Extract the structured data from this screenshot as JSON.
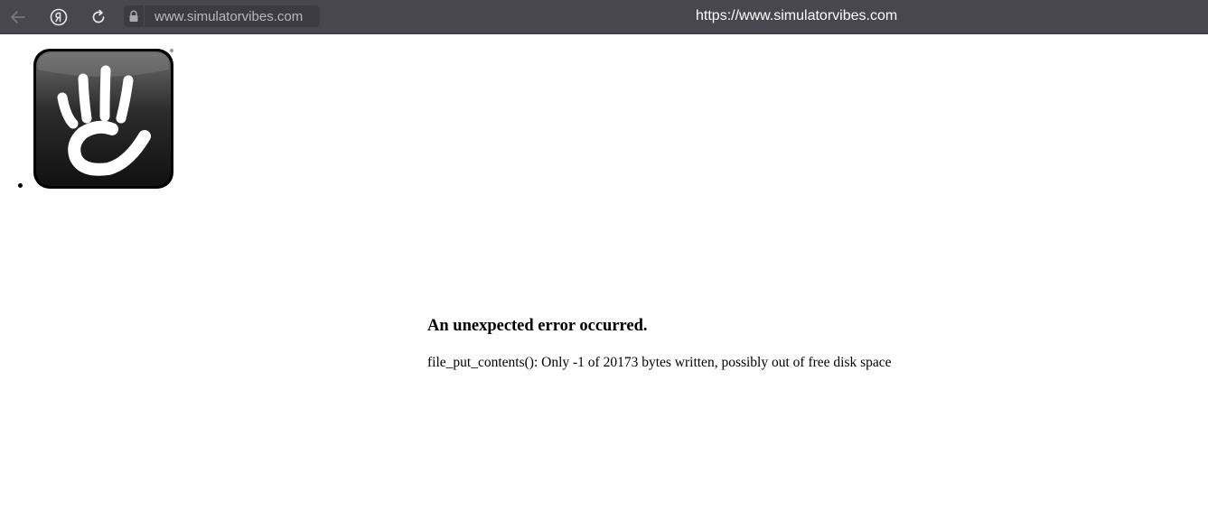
{
  "browser": {
    "address_text": "www.simulatorvibes.com",
    "page_title": "https://www.simulatorvibes.com",
    "icons": [
      "back-arrow-icon",
      "yandex-icon",
      "reload-icon",
      "lock-icon"
    ]
  },
  "colors": {
    "topbar_bg": "#48474f",
    "address_bg": "#3c3b42",
    "logo_bg": "#1a1a1a",
    "page_bg": "#ffffff"
  },
  "main": {
    "logo_icon": "concrete5-hand-logo",
    "error_heading": "An unexpected error occurred.",
    "error_message": "file_put_contents(): Only -1 of 20173 bytes written, possibly out of free disk space"
  }
}
